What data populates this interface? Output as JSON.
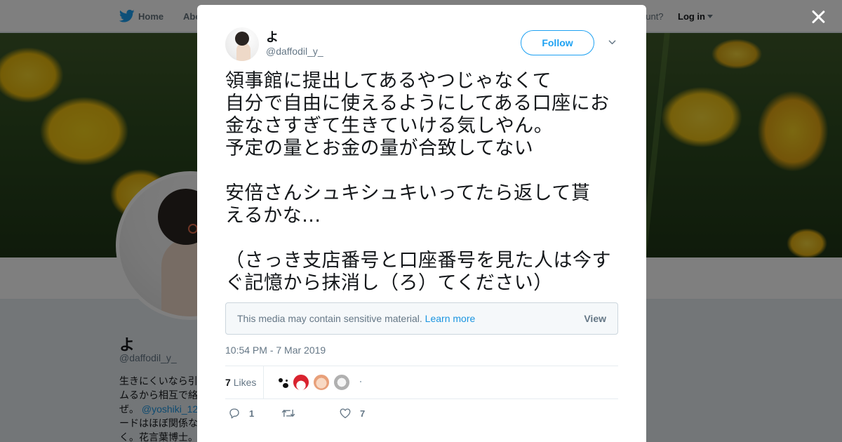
{
  "background": {
    "nav": {
      "home_label": "Home",
      "about_label": "Abo",
      "account_prompt": "ccount?",
      "login_label": "Log in"
    },
    "profile": {
      "name": "よ",
      "handle": "@daffodil_y_",
      "bio_lines": [
        "生きにくいなら引",
        "ムるから相互で絡",
        "ぜ。",
        "ードはほぼ関係な",
        "く。花言葉博士。"
      ],
      "bio_link": "@yoshiki_12"
    }
  },
  "tweet": {
    "user": {
      "name": "よ",
      "handle": "@daffodil_y_",
      "avatar_icon": "avatar-photo-icon"
    },
    "follow_label": "Follow",
    "text": {
      "para1": "領事館に提出してあるやつじゃなくて\n自分で自由に使えるようにしてある口座にお\n金なさすぎて生きていける気しやん。\n予定の量とお金の量が合致してない",
      "para2": "安倍さんシュキシュキいってたら返して貰\nえるかな...",
      "para3": "（さっき支店番号と口座番号を見た人は今す\nぐ記憶から抹消し（ろ）てください）"
    },
    "sensitive": {
      "message": "This media may contain sensitive material.",
      "learn_more": "Learn more",
      "view_label": "View"
    },
    "timestamp": "10:54 PM - 7 Mar 2019",
    "likes": {
      "count": "7",
      "label": "Likes"
    },
    "actions": {
      "reply_count": "1",
      "retweet_count": "",
      "like_count": "7"
    }
  },
  "colors": {
    "twitter_blue": "#1da1f2",
    "link_blue": "#1b95e0",
    "muted_text": "#657786"
  }
}
